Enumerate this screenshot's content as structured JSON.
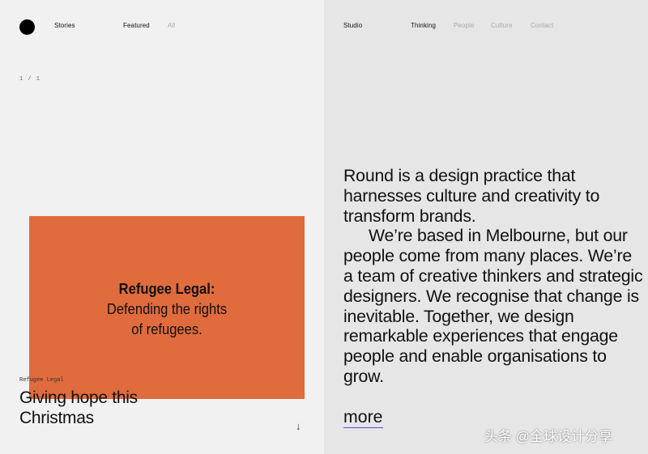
{
  "left_panel": {
    "nav": {
      "stories": "Stories",
      "featured": "Featured",
      "all": "All"
    },
    "pager": "1 / 1",
    "card": {
      "title": "Refugee Legal:",
      "line1": "Defending the rights",
      "line2": "of refugees."
    },
    "story": {
      "tag": "Refugee Legal",
      "title_line1": "Giving hope this",
      "title_line2": "Christmas"
    },
    "scroll_arrow": "↓"
  },
  "right_panel": {
    "nav": {
      "studio": "Studio",
      "thinking": "Thinking",
      "people": "People",
      "culture": "Culture",
      "contact": "Contact"
    },
    "about": {
      "paragraph1": "Round is a design practice that harnesses culture and creativity to transform brands.",
      "paragraph2": "We’re based in Melbourne, but our people come from many places. We’re a team of creative thinkers and strategic designers. We recognise that change is inevitable. Together, we design remarkable experiences that engage people and enable organisations to grow."
    },
    "more_link": "more"
  },
  "watermark": "头条 @全球设计分享",
  "colors": {
    "left_bg": "#f1f1f1",
    "right_bg": "#e6e6e6",
    "card_orange": "#e06b3d",
    "link_underline": "#4a54d6",
    "muted_nav": "#a9a9a9"
  }
}
